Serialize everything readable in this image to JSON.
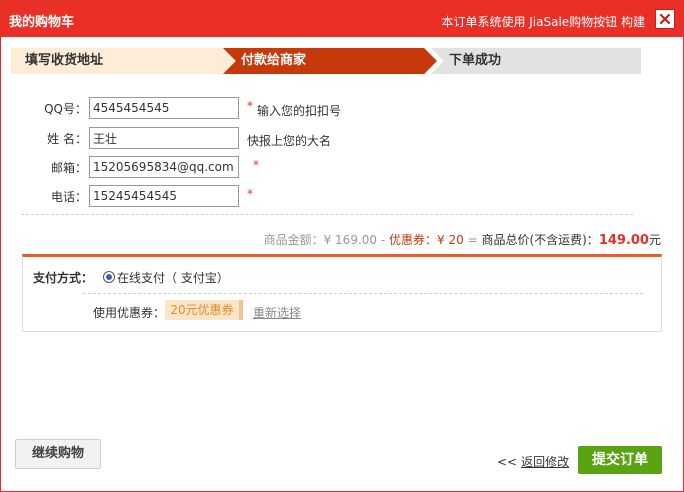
{
  "window": {
    "title": "我的购物车",
    "note": "本订单系统使用 JiaSale购物按钮 构建"
  },
  "steps": [
    {
      "label": "填写收货地址"
    },
    {
      "label": "付款给商家"
    },
    {
      "label": "下单成功"
    }
  ],
  "form": {
    "qq": {
      "label": "QQ号：",
      "value": "4545454545",
      "hint": "输入您的扣扣号"
    },
    "name": {
      "label": "姓  名：",
      "value": "王壮",
      "hint": "快报上您的大名"
    },
    "email": {
      "label": "邮箱：",
      "value": "15205695834@qq.com"
    },
    "phone": {
      "label": "电话：",
      "value": "15245454545"
    },
    "required_mark": "*"
  },
  "totals": {
    "goods_label": "商品金额：¥ 169.00",
    "minus": " - ",
    "coupon": "优惠券：¥ 20",
    "equals": " = ",
    "sum_label": "商品总价(不含运费)：",
    "sum_value": "149.00",
    "currency": "元"
  },
  "payment": {
    "label": "支付方式：",
    "option": "在线支付（ 支付宝）",
    "coupon_label": "使用优惠券：",
    "coupon_value": "20元优惠券",
    "reselect": "重新选择"
  },
  "actions": {
    "continue": "继续购物",
    "back": "返回修改",
    "back_chev": "<<",
    "submit": "提交订单"
  },
  "colors": {
    "accent": "#ea2f27",
    "step_active": "#c5390b",
    "submit": "#5aa313"
  }
}
